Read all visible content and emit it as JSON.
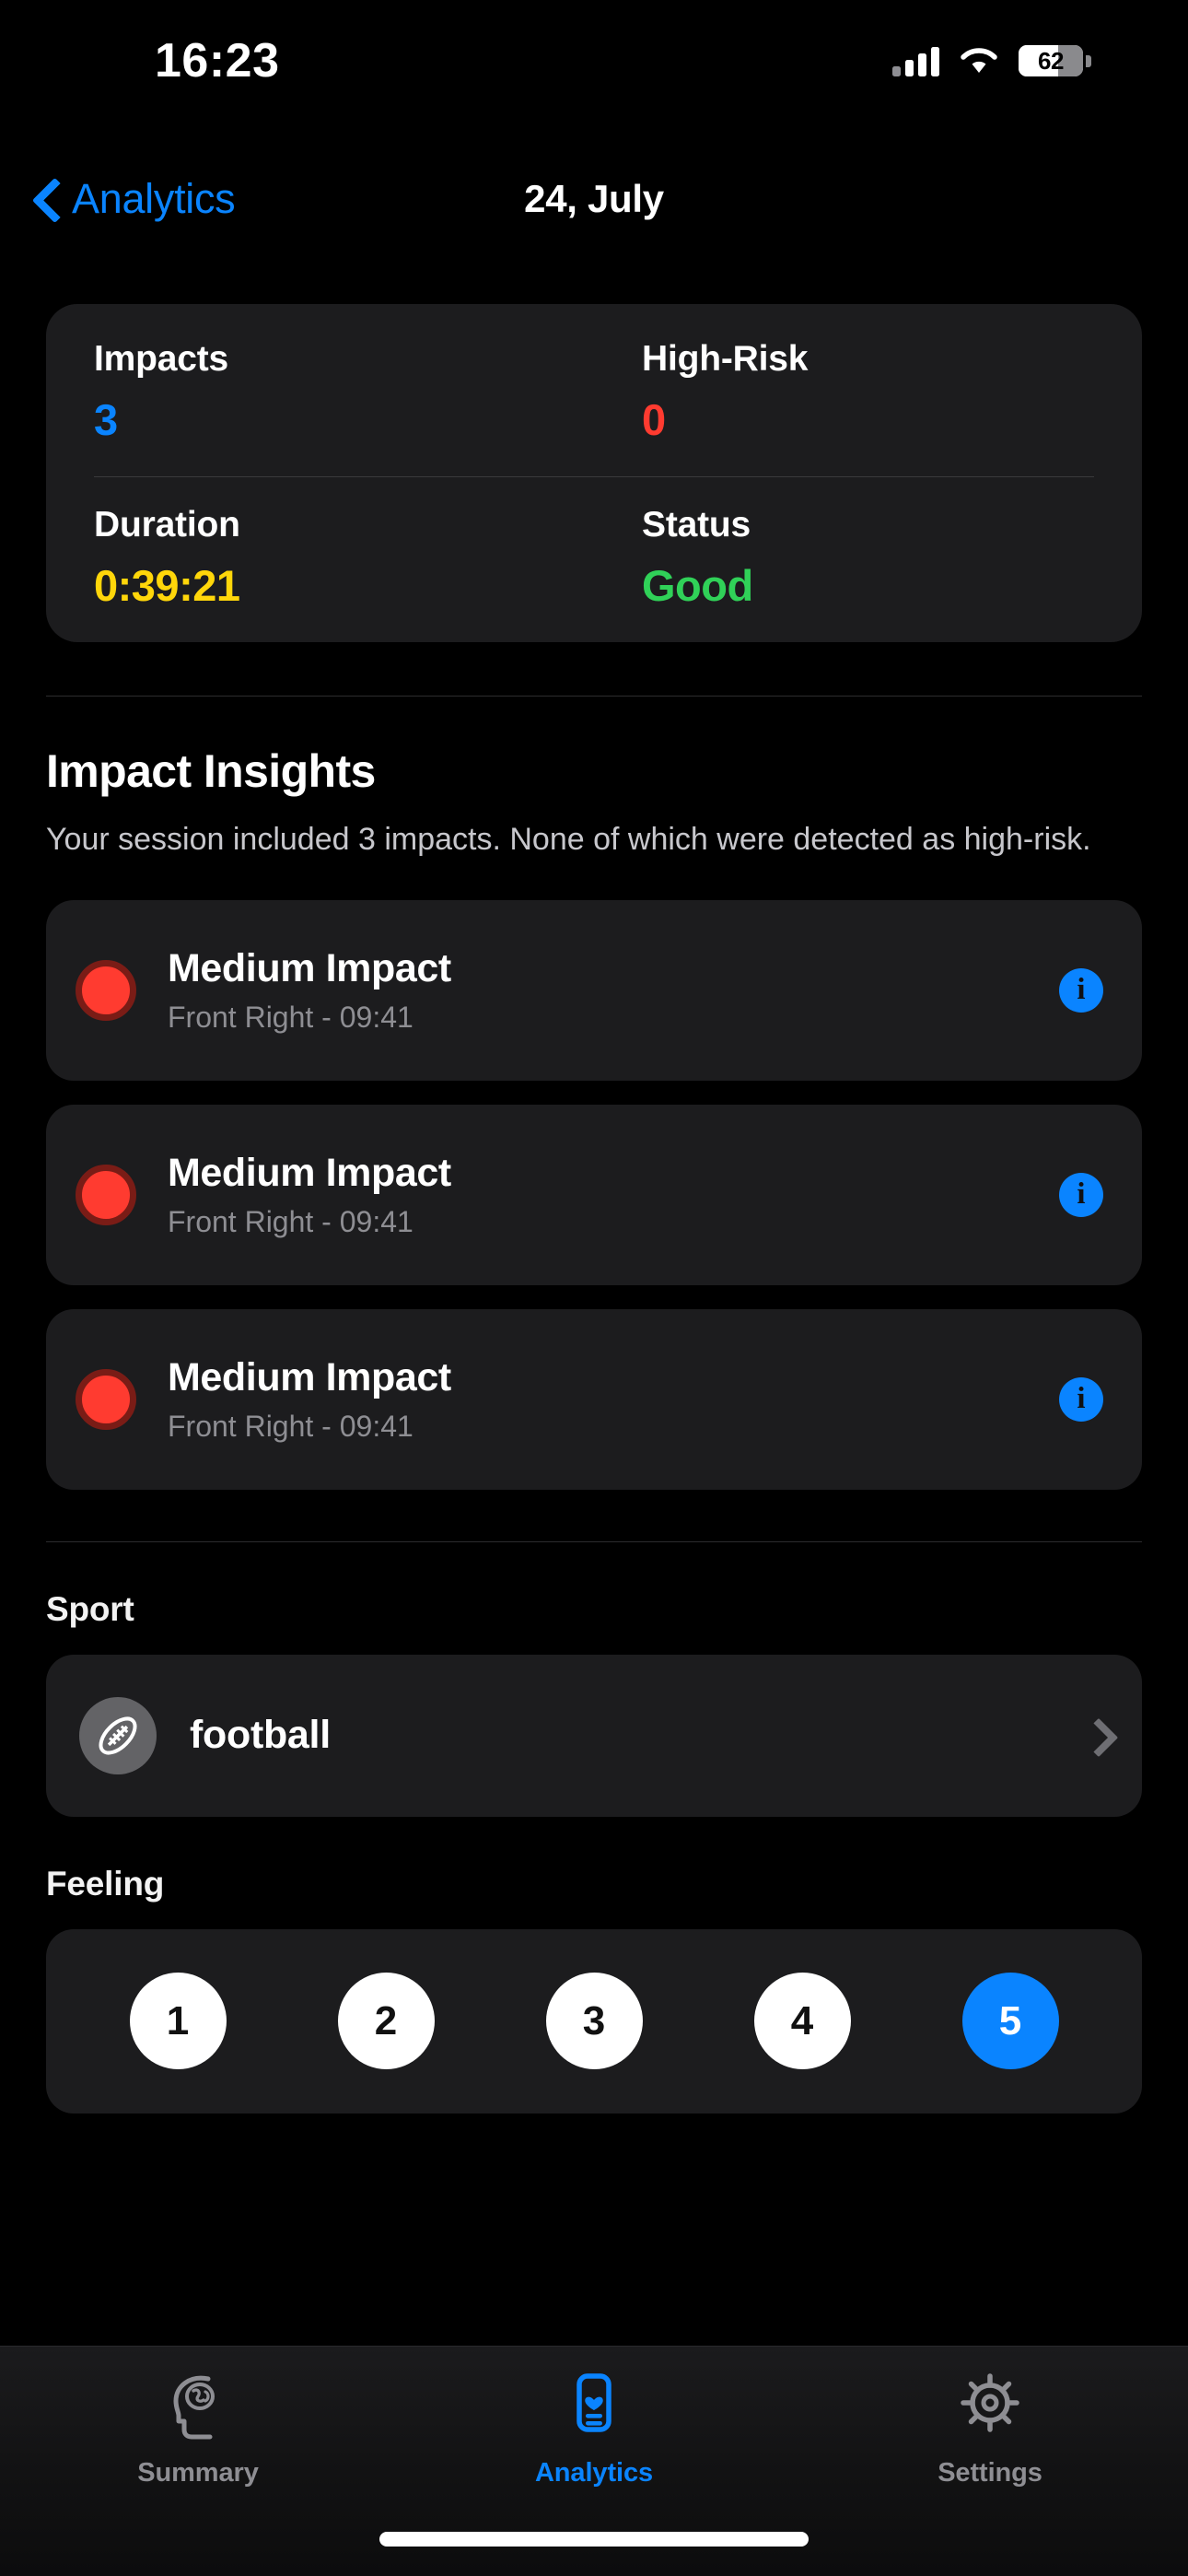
{
  "status_bar": {
    "time": "16:23",
    "battery_percent": "62",
    "battery_level_fraction": 0.62,
    "cellular_icon": "cellular-bars-icon",
    "wifi_icon": "wifi-icon",
    "battery_icon": "battery-icon"
  },
  "nav": {
    "back_label": "Analytics",
    "back_icon": "chevron-left-icon",
    "title": "24, July"
  },
  "stats": {
    "items": [
      {
        "label": "Impacts",
        "value": "3",
        "color": "#0a84ff"
      },
      {
        "label": "High-Risk",
        "value": "0",
        "color": "#ff3b30"
      },
      {
        "label": "Duration",
        "value": "0:39:21",
        "color": "#ffd60a"
      },
      {
        "label": "Status",
        "value": "Good",
        "color": "#30d158"
      }
    ]
  },
  "insights": {
    "title": "Impact Insights",
    "description": "Your session included 3 impacts. None of which were detected as high-risk.",
    "impacts": [
      {
        "title": "Medium Impact",
        "subtitle": "Front Right - 09:41",
        "severity_color": "#ff3b30",
        "info_icon": "info-icon",
        "info_label": "i"
      },
      {
        "title": "Medium Impact",
        "subtitle": "Front Right - 09:41",
        "severity_color": "#ff3b30",
        "info_icon": "info-icon",
        "info_label": "i"
      },
      {
        "title": "Medium Impact",
        "subtitle": "Front Right - 09:41",
        "severity_color": "#ff3b30",
        "info_icon": "info-icon",
        "info_label": "i"
      }
    ]
  },
  "sport": {
    "heading": "Sport",
    "name": "football",
    "icon": "football-icon",
    "chevron": "chevron-right-icon"
  },
  "feeling": {
    "heading": "Feeling",
    "options": [
      "1",
      "2",
      "3",
      "4",
      "5"
    ],
    "selected": "5",
    "selected_color": "#0a84ff"
  },
  "tabbar": {
    "items": [
      {
        "label": "Summary",
        "icon": "head-brain-icon",
        "active": false
      },
      {
        "label": "Analytics",
        "icon": "health-card-icon",
        "active": true
      },
      {
        "label": "Settings",
        "icon": "gear-icon",
        "active": false
      }
    ],
    "active_color": "#0a84ff",
    "inactive_color": "#8e8e93"
  }
}
